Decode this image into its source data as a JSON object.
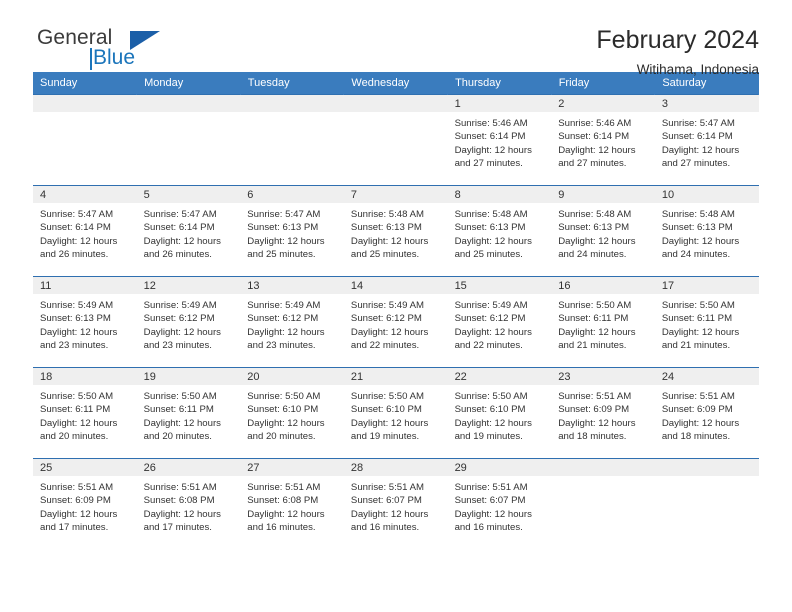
{
  "brand": {
    "name_top": "General",
    "name_bottom": "Blue",
    "accent_color": "#1b75bb",
    "triangle_color": "#1b5fa8"
  },
  "header": {
    "title": "February 2024",
    "subtitle": "Witihama, Indonesia"
  },
  "calendar": {
    "header_bg": "#3a7cbe",
    "row_rule_color": "#2f6fb0",
    "daynum_strip_bg": "#efefef",
    "weekdays": [
      "Sunday",
      "Monday",
      "Tuesday",
      "Wednesday",
      "Thursday",
      "Friday",
      "Saturday"
    ],
    "weeks": [
      [
        {
          "day": "",
          "lines": []
        },
        {
          "day": "",
          "lines": []
        },
        {
          "day": "",
          "lines": []
        },
        {
          "day": "",
          "lines": []
        },
        {
          "day": "1",
          "lines": [
            "Sunrise: 5:46 AM",
            "Sunset: 6:14 PM",
            "Daylight: 12 hours",
            "and 27 minutes."
          ]
        },
        {
          "day": "2",
          "lines": [
            "Sunrise: 5:46 AM",
            "Sunset: 6:14 PM",
            "Daylight: 12 hours",
            "and 27 minutes."
          ]
        },
        {
          "day": "3",
          "lines": [
            "Sunrise: 5:47 AM",
            "Sunset: 6:14 PM",
            "Daylight: 12 hours",
            "and 27 minutes."
          ]
        }
      ],
      [
        {
          "day": "4",
          "lines": [
            "Sunrise: 5:47 AM",
            "Sunset: 6:14 PM",
            "Daylight: 12 hours",
            "and 26 minutes."
          ]
        },
        {
          "day": "5",
          "lines": [
            "Sunrise: 5:47 AM",
            "Sunset: 6:14 PM",
            "Daylight: 12 hours",
            "and 26 minutes."
          ]
        },
        {
          "day": "6",
          "lines": [
            "Sunrise: 5:47 AM",
            "Sunset: 6:13 PM",
            "Daylight: 12 hours",
            "and 25 minutes."
          ]
        },
        {
          "day": "7",
          "lines": [
            "Sunrise: 5:48 AM",
            "Sunset: 6:13 PM",
            "Daylight: 12 hours",
            "and 25 minutes."
          ]
        },
        {
          "day": "8",
          "lines": [
            "Sunrise: 5:48 AM",
            "Sunset: 6:13 PM",
            "Daylight: 12 hours",
            "and 25 minutes."
          ]
        },
        {
          "day": "9",
          "lines": [
            "Sunrise: 5:48 AM",
            "Sunset: 6:13 PM",
            "Daylight: 12 hours",
            "and 24 minutes."
          ]
        },
        {
          "day": "10",
          "lines": [
            "Sunrise: 5:48 AM",
            "Sunset: 6:13 PM",
            "Daylight: 12 hours",
            "and 24 minutes."
          ]
        }
      ],
      [
        {
          "day": "11",
          "lines": [
            "Sunrise: 5:49 AM",
            "Sunset: 6:13 PM",
            "Daylight: 12 hours",
            "and 23 minutes."
          ]
        },
        {
          "day": "12",
          "lines": [
            "Sunrise: 5:49 AM",
            "Sunset: 6:12 PM",
            "Daylight: 12 hours",
            "and 23 minutes."
          ]
        },
        {
          "day": "13",
          "lines": [
            "Sunrise: 5:49 AM",
            "Sunset: 6:12 PM",
            "Daylight: 12 hours",
            "and 23 minutes."
          ]
        },
        {
          "day": "14",
          "lines": [
            "Sunrise: 5:49 AM",
            "Sunset: 6:12 PM",
            "Daylight: 12 hours",
            "and 22 minutes."
          ]
        },
        {
          "day": "15",
          "lines": [
            "Sunrise: 5:49 AM",
            "Sunset: 6:12 PM",
            "Daylight: 12 hours",
            "and 22 minutes."
          ]
        },
        {
          "day": "16",
          "lines": [
            "Sunrise: 5:50 AM",
            "Sunset: 6:11 PM",
            "Daylight: 12 hours",
            "and 21 minutes."
          ]
        },
        {
          "day": "17",
          "lines": [
            "Sunrise: 5:50 AM",
            "Sunset: 6:11 PM",
            "Daylight: 12 hours",
            "and 21 minutes."
          ]
        }
      ],
      [
        {
          "day": "18",
          "lines": [
            "Sunrise: 5:50 AM",
            "Sunset: 6:11 PM",
            "Daylight: 12 hours",
            "and 20 minutes."
          ]
        },
        {
          "day": "19",
          "lines": [
            "Sunrise: 5:50 AM",
            "Sunset: 6:11 PM",
            "Daylight: 12 hours",
            "and 20 minutes."
          ]
        },
        {
          "day": "20",
          "lines": [
            "Sunrise: 5:50 AM",
            "Sunset: 6:10 PM",
            "Daylight: 12 hours",
            "and 20 minutes."
          ]
        },
        {
          "day": "21",
          "lines": [
            "Sunrise: 5:50 AM",
            "Sunset: 6:10 PM",
            "Daylight: 12 hours",
            "and 19 minutes."
          ]
        },
        {
          "day": "22",
          "lines": [
            "Sunrise: 5:50 AM",
            "Sunset: 6:10 PM",
            "Daylight: 12 hours",
            "and 19 minutes."
          ]
        },
        {
          "day": "23",
          "lines": [
            "Sunrise: 5:51 AM",
            "Sunset: 6:09 PM",
            "Daylight: 12 hours",
            "and 18 minutes."
          ]
        },
        {
          "day": "24",
          "lines": [
            "Sunrise: 5:51 AM",
            "Sunset: 6:09 PM",
            "Daylight: 12 hours",
            "and 18 minutes."
          ]
        }
      ],
      [
        {
          "day": "25",
          "lines": [
            "Sunrise: 5:51 AM",
            "Sunset: 6:09 PM",
            "Daylight: 12 hours",
            "and 17 minutes."
          ]
        },
        {
          "day": "26",
          "lines": [
            "Sunrise: 5:51 AM",
            "Sunset: 6:08 PM",
            "Daylight: 12 hours",
            "and 17 minutes."
          ]
        },
        {
          "day": "27",
          "lines": [
            "Sunrise: 5:51 AM",
            "Sunset: 6:08 PM",
            "Daylight: 12 hours",
            "and 16 minutes."
          ]
        },
        {
          "day": "28",
          "lines": [
            "Sunrise: 5:51 AM",
            "Sunset: 6:07 PM",
            "Daylight: 12 hours",
            "and 16 minutes."
          ]
        },
        {
          "day": "29",
          "lines": [
            "Sunrise: 5:51 AM",
            "Sunset: 6:07 PM",
            "Daylight: 12 hours",
            "and 16 minutes."
          ]
        },
        {
          "day": "",
          "lines": []
        },
        {
          "day": "",
          "lines": []
        }
      ]
    ]
  }
}
